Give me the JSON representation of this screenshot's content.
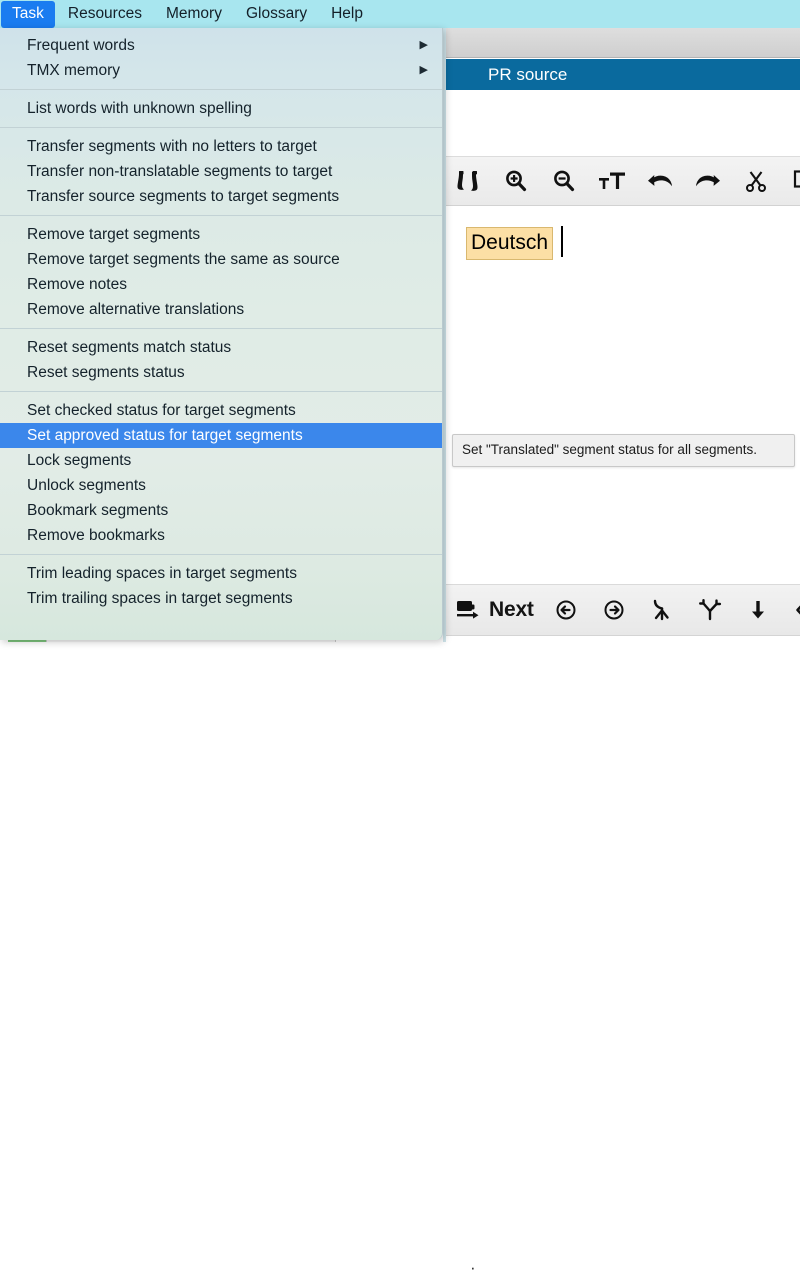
{
  "menubar": {
    "items": [
      {
        "label": "Task",
        "active": true
      },
      {
        "label": "Resources",
        "active": false
      },
      {
        "label": "Memory",
        "active": false
      },
      {
        "label": "Glossary",
        "active": false
      },
      {
        "label": "Help",
        "active": false
      }
    ]
  },
  "task_menu": {
    "groups": [
      {
        "items": [
          {
            "label": "Frequent words",
            "submenu": true
          },
          {
            "label": "TMX memory",
            "submenu": true
          }
        ]
      },
      {
        "items": [
          {
            "label": "List words with unknown spelling",
            "submenu": false
          }
        ]
      },
      {
        "items": [
          {
            "label": "Transfer segments with no letters to target",
            "submenu": false
          },
          {
            "label": "Transfer non-translatable segments to target",
            "submenu": false
          },
          {
            "label": "Transfer source segments to target segments",
            "submenu": false
          }
        ]
      },
      {
        "items": [
          {
            "label": "Remove target segments",
            "submenu": false
          },
          {
            "label": "Remove target segments the same as source",
            "submenu": false
          },
          {
            "label": "Remove notes",
            "submenu": false
          },
          {
            "label": "Remove alternative translations",
            "submenu": false
          }
        ]
      },
      {
        "items": [
          {
            "label": "Reset segments match status",
            "submenu": false
          },
          {
            "label": "Reset segments status",
            "submenu": false
          }
        ]
      },
      {
        "items": [
          {
            "label": "Set checked status for target segments",
            "submenu": false
          },
          {
            "label": "Set approved status for target segments",
            "submenu": false,
            "selected": true
          },
          {
            "label": "Lock segments",
            "submenu": false
          },
          {
            "label": "Unlock segments",
            "submenu": false
          },
          {
            "label": "Bookmark segments",
            "submenu": false
          },
          {
            "label": "Remove bookmarks",
            "submenu": false
          }
        ]
      },
      {
        "items": [
          {
            "label": "Trim leading spaces in target segments",
            "submenu": false
          },
          {
            "label": "Trim trailing spaces in target segments",
            "submenu": false
          }
        ]
      }
    ],
    "submenu_arrow_glyph": "▶"
  },
  "panel": {
    "title": "PR source"
  },
  "edit_toolbar": {
    "icons": [
      "find-icon",
      "zoom-in-icon",
      "zoom-out-icon",
      "font-size-icon",
      "undo-icon",
      "redo-icon",
      "cut-icon",
      "copy-icon"
    ]
  },
  "editor": {
    "segment_text": "Deutsch"
  },
  "tooltip": {
    "text": "Set \"Translated\" segment status for all segments."
  },
  "bottom_toolbar": {
    "next_label": "Next",
    "icons": [
      "next-segment-icon",
      "previous-segment-icon",
      "forward-segment-icon",
      "merge-segments-icon",
      "split-segment-icon",
      "move-down-icon",
      "move-left-icon"
    ]
  },
  "status_bar": {
    "marker": "·"
  },
  "colors": {
    "menubar_background": "#a8e6ef",
    "menubar_active": "#1a7cf0",
    "menu_selected": "#3b87eb",
    "panel_title_background": "#0a6a9e",
    "segment_highlight": "#fcdfa5",
    "progress_green": "#7dc47d"
  }
}
